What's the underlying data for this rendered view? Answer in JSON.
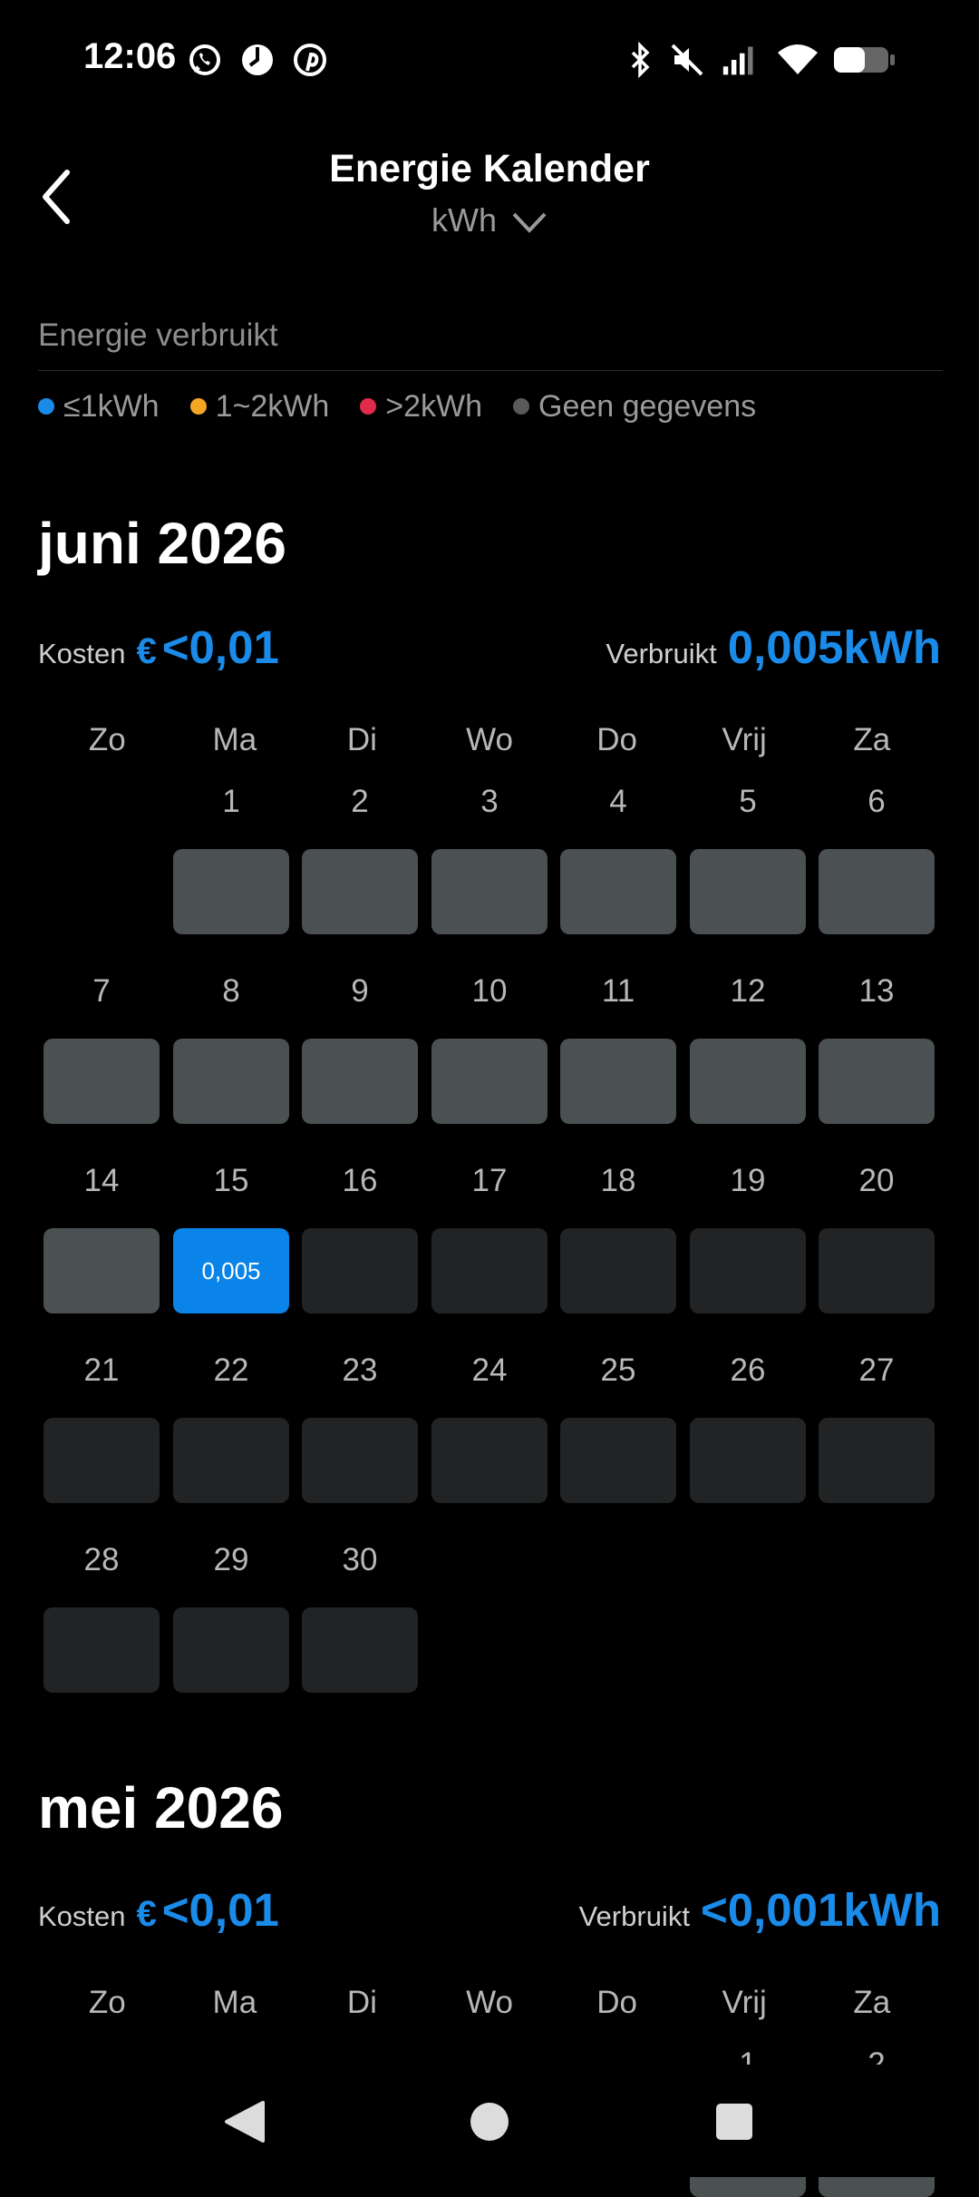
{
  "status_bar": {
    "time": "12:06",
    "notification_icons": [
      "whatsapp-icon",
      "clock-icon",
      "pinterest-icon"
    ],
    "system_icons": [
      "bluetooth-icon",
      "mute-icon",
      "signal-icon",
      "wifi-icon",
      "battery-icon"
    ]
  },
  "header": {
    "title": "Energie Kalender",
    "unit": "kWh"
  },
  "section_label": "Energie verbruikt",
  "legend": [
    {
      "label": "≤1kWh",
      "color": "#1a8be8"
    },
    {
      "label": "1~2kWh",
      "color": "#f5a623"
    },
    {
      "label": ">2kWh",
      "color": "#e02b4a"
    },
    {
      "label": "Geen gegevens",
      "color": "#5a5a5a"
    }
  ],
  "weekdays": [
    "Zo",
    "Ma",
    "Di",
    "Wo",
    "Do",
    "Vrij",
    "Za"
  ],
  "colors": {
    "accent": "#1a8be8",
    "no_data": "#4b5052",
    "future": "#222325"
  },
  "months": [
    {
      "title": "juni 2026",
      "cost_label": "Kosten",
      "currency": "€",
      "cost_value": "<0,01",
      "usage_label": "Verbruikt",
      "usage_value": "0,005kWh",
      "first_weekday_index": 1,
      "days": [
        {
          "day": "1",
          "status": "nodata",
          "value": ""
        },
        {
          "day": "2",
          "status": "nodata",
          "value": ""
        },
        {
          "day": "3",
          "status": "nodata",
          "value": ""
        },
        {
          "day": "4",
          "status": "nodata",
          "value": ""
        },
        {
          "day": "5",
          "status": "nodata",
          "value": ""
        },
        {
          "day": "6",
          "status": "nodata",
          "value": ""
        },
        {
          "day": "7",
          "status": "nodata",
          "value": ""
        },
        {
          "day": "8",
          "status": "nodata",
          "value": ""
        },
        {
          "day": "9",
          "status": "nodata",
          "value": ""
        },
        {
          "day": "10",
          "status": "nodata",
          "value": ""
        },
        {
          "day": "11",
          "status": "nodata",
          "value": ""
        },
        {
          "day": "12",
          "status": "nodata",
          "value": ""
        },
        {
          "day": "13",
          "status": "nodata",
          "value": ""
        },
        {
          "day": "14",
          "status": "nodata",
          "value": ""
        },
        {
          "day": "15",
          "status": "low",
          "value": "0,005"
        },
        {
          "day": "16",
          "status": "future",
          "value": ""
        },
        {
          "day": "17",
          "status": "future",
          "value": ""
        },
        {
          "day": "18",
          "status": "future",
          "value": ""
        },
        {
          "day": "19",
          "status": "future",
          "value": ""
        },
        {
          "day": "20",
          "status": "future",
          "value": ""
        },
        {
          "day": "21",
          "status": "future",
          "value": ""
        },
        {
          "day": "22",
          "status": "future",
          "value": ""
        },
        {
          "day": "23",
          "status": "future",
          "value": ""
        },
        {
          "day": "24",
          "status": "future",
          "value": ""
        },
        {
          "day": "25",
          "status": "future",
          "value": ""
        },
        {
          "day": "26",
          "status": "future",
          "value": ""
        },
        {
          "day": "27",
          "status": "future",
          "value": ""
        },
        {
          "day": "28",
          "status": "future",
          "value": ""
        },
        {
          "day": "29",
          "status": "future",
          "value": ""
        },
        {
          "day": "30",
          "status": "future",
          "value": ""
        }
      ]
    },
    {
      "title": "mei 2026",
      "cost_label": "Kosten",
      "currency": "€",
      "cost_value": "<0,01",
      "usage_label": "Verbruikt",
      "usage_value": "<0,001kWh",
      "first_weekday_index": 5,
      "days": [
        {
          "day": "1",
          "status": "nodata",
          "value": ""
        },
        {
          "day": "2",
          "status": "nodata",
          "value": ""
        }
      ]
    }
  ],
  "nav": [
    "back-nav-icon",
    "home-nav-icon",
    "recents-nav-icon"
  ]
}
